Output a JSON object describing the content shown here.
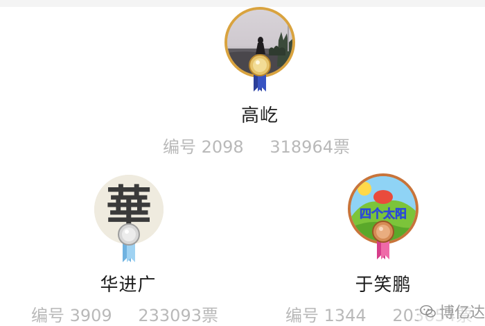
{
  "contestants": [
    {
      "name": "高屹",
      "number_text": "编号 2098",
      "votes_text": "318964票",
      "rank_medal": "gold",
      "avatar_description": "photo"
    },
    {
      "name": "华进广",
      "number_text": "编号 3909",
      "votes_text": "233093票",
      "rank_medal": "silver",
      "avatar_description": "calligraphy",
      "avatar_text": "華"
    },
    {
      "name": "于笑鹏",
      "number_text": "编号 1344",
      "votes_text": "203654票",
      "rank_medal": "bronze",
      "avatar_description": "cartoon",
      "avatar_text": "四个太阳"
    }
  ],
  "watermark": {
    "text": "博亿达",
    "icon": "wechat-icon"
  },
  "colors": {
    "gold": "#d9a33f",
    "silver": "#c9c9c9",
    "bronze": "#c8743a",
    "gray_text": "#b9b9b9",
    "name_text": "#1c1c1c"
  }
}
